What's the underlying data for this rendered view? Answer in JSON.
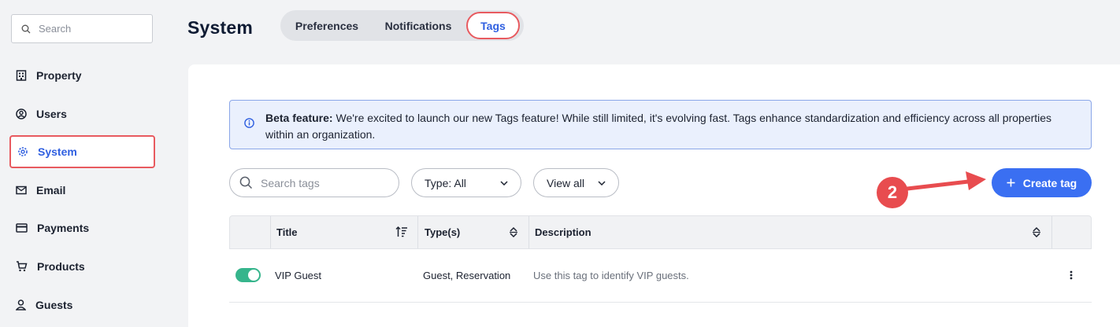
{
  "sidebar": {
    "search_placeholder": "Search",
    "items": [
      {
        "label": "Property",
        "icon": "building-icon"
      },
      {
        "label": "Users",
        "icon": "user-circle-icon"
      },
      {
        "label": "System",
        "icon": "gear-icon",
        "active": true
      },
      {
        "label": "Email",
        "icon": "envelope-icon"
      },
      {
        "label": "Payments",
        "icon": "credit-card-icon"
      },
      {
        "label": "Products",
        "icon": "cart-icon"
      },
      {
        "label": "Guests",
        "icon": "person-icon"
      }
    ]
  },
  "header": {
    "title": "System",
    "tabs": [
      {
        "label": "Preferences"
      },
      {
        "label": "Notifications"
      },
      {
        "label": "Tags",
        "active": true
      }
    ]
  },
  "banner": {
    "bold": "Beta feature:",
    "text": " We're excited to launch our new Tags feature! While still limited, it's evolving fast. Tags enhance standardization and efficiency across all properties within an organization."
  },
  "toolbar": {
    "search_placeholder": "Search tags",
    "type_filter": "Type: All",
    "view_filter": "View all",
    "create_label": "Create tag",
    "annotation_number": "2"
  },
  "table": {
    "columns": [
      "Title",
      "Type(s)",
      "Description"
    ],
    "rows": [
      {
        "enabled": true,
        "title": "VIP Guest",
        "types": "Guest, Reservation",
        "description": "Use this tag to identify VIP guests."
      }
    ]
  },
  "colors": {
    "accent": "#3a6ff2",
    "highlight": "#e85a5f",
    "toggle_on": "#36b58c"
  }
}
